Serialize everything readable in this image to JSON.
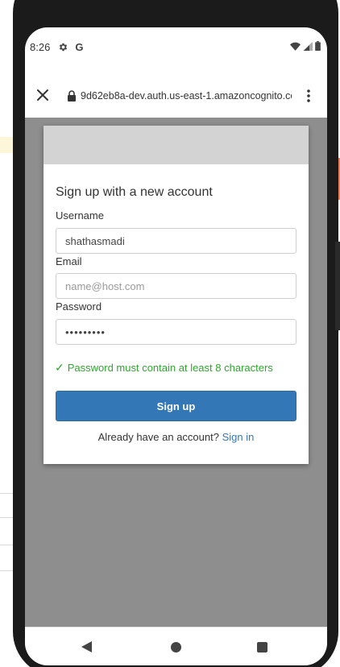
{
  "status_bar": {
    "time": "8:26",
    "settings_icon": "gear-icon",
    "g_label": "G",
    "wifi_icon": "wifi-icon",
    "signal_icon": "signal-icon",
    "battery_icon": "battery-icon"
  },
  "browser": {
    "close_icon": "close-icon",
    "lock_icon": "lock-icon",
    "url": "9d62eb8a-dev.auth.us-east-1.amazoncognito.com",
    "menu_icon": "more-vert-icon"
  },
  "form": {
    "title": "Sign up with a new account",
    "username_label": "Username",
    "username_value": "shathasmadi",
    "email_label": "Email",
    "email_placeholder": "name@host.com",
    "password_label": "Password",
    "password_value": "shatha123",
    "rule_check": "✓",
    "rule_text": "Password must contain at least 8 characters",
    "signup_label": "Sign up",
    "signin_prompt": "Already have an account?",
    "signin_link": "Sign in"
  },
  "nav": {
    "back_icon": "back-icon",
    "home_icon": "home-icon",
    "recents_icon": "recents-icon"
  },
  "colors": {
    "accent": "#3477b6",
    "success": "#2fa62f",
    "page_background": "#8e8e8e"
  }
}
